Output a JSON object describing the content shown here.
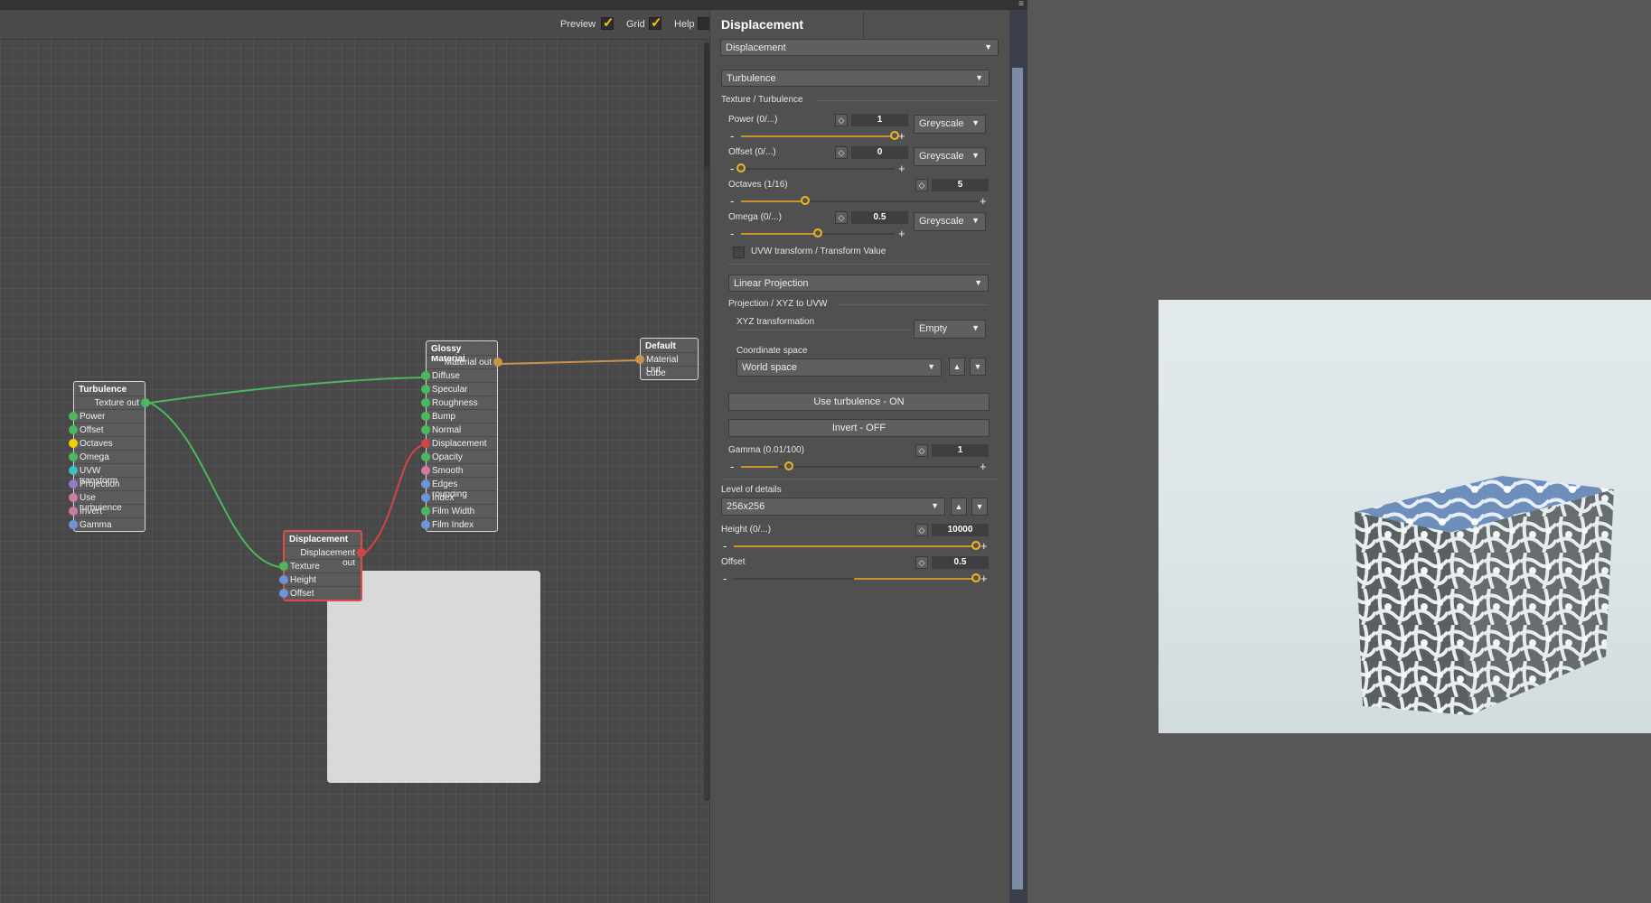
{
  "toolbar": {
    "preview_label": "Preview",
    "grid_label": "Grid",
    "help_label": "Help",
    "preview_checked": true,
    "grid_checked": true,
    "help_checked": false
  },
  "nodes": {
    "turbulence": {
      "title": "Turbulence",
      "output": "Texture out",
      "inputs": [
        "Power",
        "Offset",
        "Octaves",
        "Omega",
        "UVW transform",
        "Projection",
        "Use turbulence",
        "Invert",
        "Gamma"
      ]
    },
    "glossy": {
      "title": "Glossy Material",
      "output": "Material out",
      "inputs": [
        "Diffuse",
        "Specular",
        "Roughness",
        "Bump",
        "Normal",
        "Displacement",
        "Opacity",
        "Smooth",
        "Edges rounding",
        "Index",
        "Film Width",
        "Film Index"
      ]
    },
    "default": {
      "title": "Default",
      "rows": [
        "Material Out",
        "cube"
      ]
    },
    "displacement": {
      "title": "Displacement",
      "output": "Displacement out",
      "inputs": [
        "Texture",
        "Height",
        "Offset"
      ]
    }
  },
  "props": {
    "header": "Displacement",
    "type_dropdown": "Displacement",
    "texture_dropdown": "Turbulence",
    "section_texture": "Texture / Turbulence",
    "power": {
      "label": "Power  (0/...)",
      "value": "1",
      "mode": "Greyscale",
      "fraction": 1.0
    },
    "offset": {
      "label": "Offset  (0/...)",
      "value": "0",
      "mode": "Greyscale",
      "fraction": 0.0
    },
    "octaves": {
      "label": "Octaves  (1/16)",
      "value": "5",
      "fraction": 0.27
    },
    "omega": {
      "label": "Omega  (0/...)",
      "value": "0.5",
      "mode": "Greyscale",
      "fraction": 0.5
    },
    "uvw_label": "UVW transform / Transform Value",
    "projection_dropdown": "Linear Projection",
    "section_projection": "Projection / XYZ to UVW",
    "xyz_label": "XYZ transformation",
    "xyz_value": "Empty",
    "coord_label": "Coordinate space",
    "coord_value": "World space",
    "use_turbulence_btn": "Use turbulence - ON",
    "invert_btn": "Invert - OFF",
    "gamma": {
      "label": "Gamma  (0.01/100)",
      "value": "1",
      "fraction": 0.2
    },
    "lod_label": "Level of details",
    "lod_value": "256x256",
    "height": {
      "label": "Height  (0/...)",
      "value": "10000",
      "fraction": 1.0
    },
    "offset2": {
      "label": "Offset",
      "value": "0.5",
      "fraction": 1.0
    }
  },
  "colors": {
    "accent": "#f2b31e",
    "wire_green": "#4cb85e",
    "wire_red": "#d24545",
    "wire_orange": "#c9934a",
    "port_green": "#4cb85e",
    "port_yellow": "#f0d000",
    "port_teal": "#3bbfbf",
    "port_purple": "#9a79c8",
    "port_pink": "#cf7aa4",
    "port_blue": "#6d94d8",
    "port_red": "#d24545"
  }
}
